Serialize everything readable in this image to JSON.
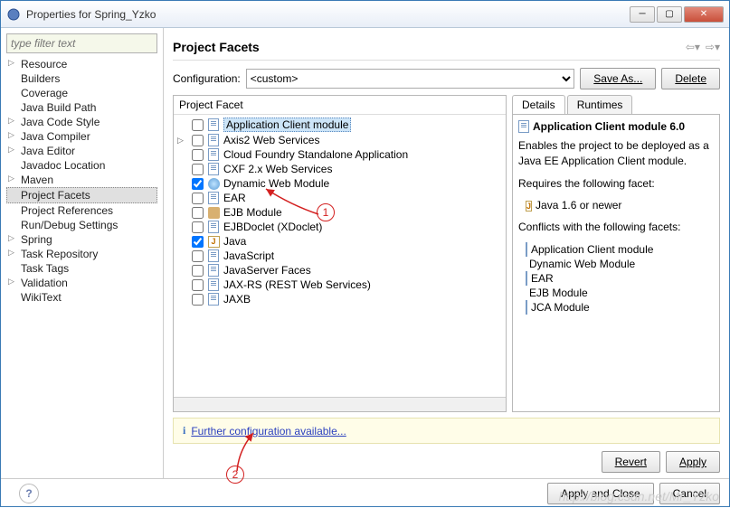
{
  "window": {
    "title": "Properties for Spring_Yzko"
  },
  "sidebar": {
    "filter_placeholder": "type filter text",
    "items": [
      {
        "label": "Resource",
        "expandable": true
      },
      {
        "label": "Builders"
      },
      {
        "label": "Coverage"
      },
      {
        "label": "Java Build Path"
      },
      {
        "label": "Java Code Style",
        "expandable": true
      },
      {
        "label": "Java Compiler",
        "expandable": true
      },
      {
        "label": "Java Editor",
        "expandable": true
      },
      {
        "label": "Javadoc Location"
      },
      {
        "label": "Maven",
        "expandable": true
      },
      {
        "label": "Project Facets",
        "selected": true
      },
      {
        "label": "Project References"
      },
      {
        "label": "Run/Debug Settings"
      },
      {
        "label": "Spring",
        "expandable": true
      },
      {
        "label": "Task Repository",
        "expandable": true
      },
      {
        "label": "Task Tags"
      },
      {
        "label": "Validation",
        "expandable": true
      },
      {
        "label": "WikiText"
      }
    ]
  },
  "main": {
    "title": "Project Facets",
    "config_label": "Configuration:",
    "config_value": "<custom>",
    "save_as": "Save As...",
    "delete": "Delete",
    "facet_header": "Project Facet",
    "facets": [
      {
        "label": "Application Client module",
        "icon": "doc",
        "checked": false,
        "selected": true
      },
      {
        "label": "Axis2 Web Services",
        "icon": "doc",
        "checked": false,
        "expandable": true
      },
      {
        "label": "Cloud Foundry Standalone Application",
        "icon": "doc",
        "checked": false
      },
      {
        "label": "CXF 2.x Web Services",
        "icon": "doc",
        "checked": false
      },
      {
        "label": "Dynamic Web Module",
        "icon": "globe",
        "checked": true
      },
      {
        "label": "EAR",
        "icon": "doc",
        "checked": false
      },
      {
        "label": "EJB Module",
        "icon": "jar",
        "checked": false
      },
      {
        "label": "EJBDoclet (XDoclet)",
        "icon": "doc",
        "checked": false
      },
      {
        "label": "Java",
        "icon": "j",
        "checked": true
      },
      {
        "label": "JavaScript",
        "icon": "doc",
        "checked": false
      },
      {
        "label": "JavaServer Faces",
        "icon": "doc",
        "checked": false
      },
      {
        "label": "JAX-RS (REST Web Services)",
        "icon": "doc",
        "checked": false
      },
      {
        "label": "JAXB",
        "icon": "doc",
        "checked": false
      }
    ],
    "tabs": {
      "details": "Details",
      "runtimes": "Runtimes"
    },
    "details": {
      "title": "Application Client module 6.0",
      "desc": "Enables the project to be deployed as a Java EE Application Client module.",
      "requires_label": "Requires the following facet:",
      "requires": [
        {
          "label": "Java 1.6 or newer",
          "icon": "j"
        }
      ],
      "conflicts_label": "Conflicts with the following facets:",
      "conflicts": [
        {
          "label": "Application Client module",
          "icon": "doc"
        },
        {
          "label": "Dynamic Web Module",
          "icon": "globe"
        },
        {
          "label": "EAR",
          "icon": "doc"
        },
        {
          "label": "EJB Module",
          "icon": "jar"
        },
        {
          "label": "JCA Module",
          "icon": "doc"
        }
      ]
    },
    "info_link": "Further configuration available...",
    "revert": "Revert",
    "apply": "Apply"
  },
  "footer": {
    "apply_close": "Apply and Close",
    "cancel": "Cancel"
  },
  "annotations": {
    "one": "1",
    "two": "2"
  },
  "watermark": "http://blog.csdn.net/Mr_Yzko"
}
